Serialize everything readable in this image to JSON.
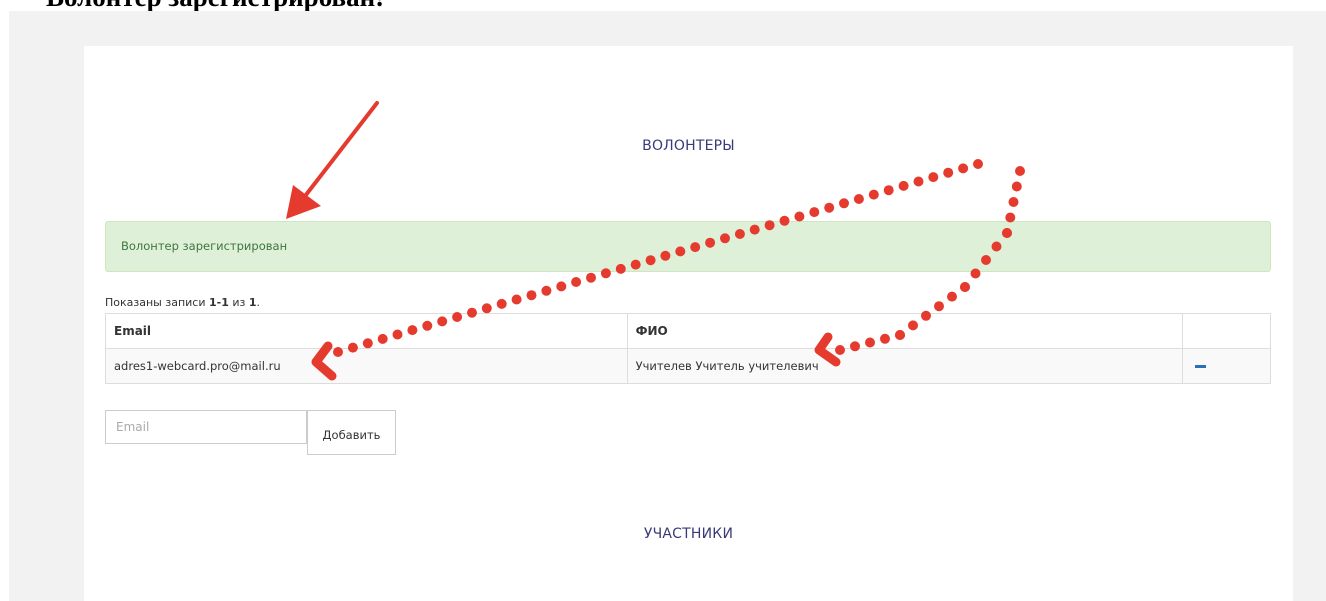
{
  "header": {
    "title_text": "Волонтер зарегистрирован!"
  },
  "sections": {
    "volunteers_title": "ВОЛОНТЕРЫ",
    "participants_title": "УЧАСТНИКИ"
  },
  "alert": {
    "message": "Волонтер зарегистрирован"
  },
  "summary": {
    "prefix": "Показаны записи ",
    "range": "1-1",
    "middle": " из ",
    "total": "1",
    "suffix": "."
  },
  "table": {
    "columns": [
      "Email",
      "ФИО",
      ""
    ],
    "rows": [
      {
        "email": "adres1-webcard.pro@mail.ru",
        "fio": "Учителев Учитель учителевич"
      }
    ]
  },
  "form": {
    "email_placeholder": "Email",
    "add_label": "Добавить"
  },
  "colors": {
    "annotation_red": "#e53b2f",
    "alert_bg": "#dff0d8",
    "section_title": "#3a3a7a",
    "remove_icon": "#2c6fb3"
  },
  "icons": {
    "remove": "minus-icon",
    "annotation_arrow": "arrow-annotation-icon",
    "annotation_dots": "dotted-arrow-annotation-icon"
  }
}
